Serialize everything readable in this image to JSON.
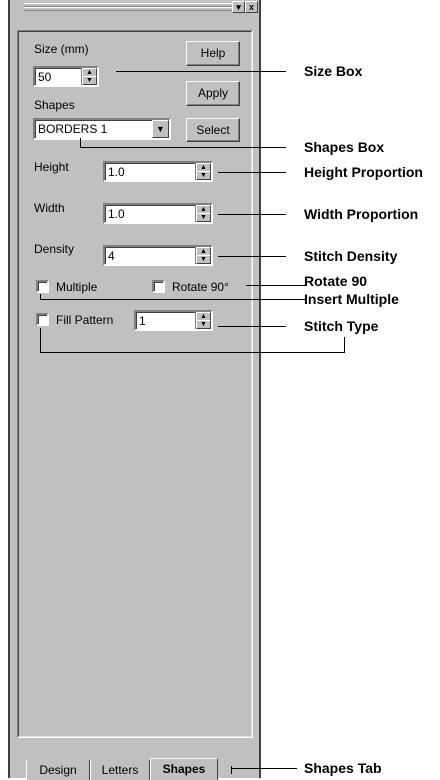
{
  "panel": {
    "titlebar_buttons": [
      "▾",
      "x"
    ],
    "size_label": "Size (mm)",
    "size_value": "50",
    "help_label": "Help",
    "apply_label": "Apply",
    "shapes_label": "Shapes",
    "shapes_value": "BORDERS 1",
    "select_label": "Select",
    "height_label": "Height",
    "height_value": "1.0",
    "width_label": "Width",
    "width_value": "1.0",
    "density_label": "Density",
    "density_value": "4",
    "multiple_label": "Multiple",
    "rotate_label": "Rotate 90°",
    "fill_label": "Fill Pattern",
    "fill_value": "1"
  },
  "tabs": [
    {
      "label": "Design",
      "active": false
    },
    {
      "label": "Letters",
      "active": false
    },
    {
      "label": "Shapes",
      "active": true
    }
  ],
  "annotations": {
    "size_box": "Size Box",
    "shapes_box": "Shapes Box",
    "height_proportion": "Height Proportion",
    "width_proportion": "Width Proportion",
    "stitch_density": "Stitch Density",
    "rotate_90": "Rotate 90",
    "insert_multiple": "Insert Multiple",
    "stitch_type": "Stitch Type",
    "shapes_tab": "Shapes Tab"
  }
}
